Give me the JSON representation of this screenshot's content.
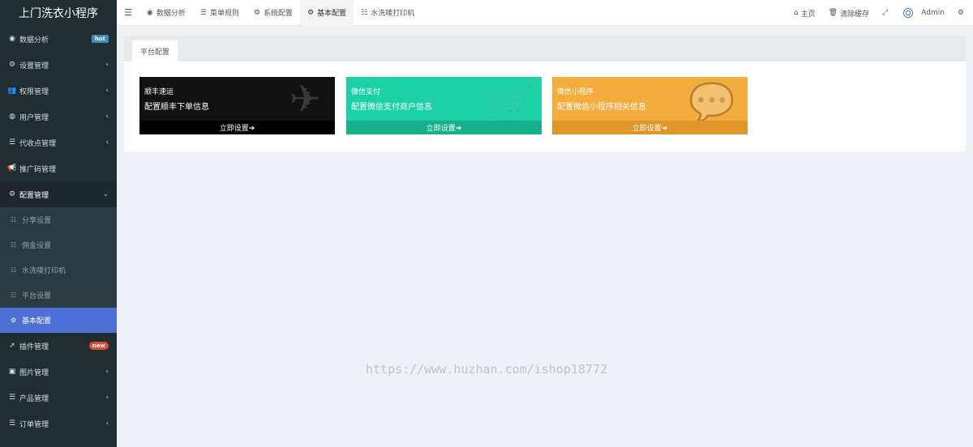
{
  "brand": "上门洗衣小程序",
  "sidebar": {
    "items": [
      {
        "label": "数据分析",
        "icon": "dashboard-icon",
        "glyph": "◉",
        "badge": "hot"
      },
      {
        "label": "设置管理",
        "icon": "cogs-icon",
        "glyph": "⚙",
        "arrow": "‹"
      },
      {
        "label": "权限管理",
        "icon": "users-icon",
        "glyph": "👥",
        "arrow": "‹"
      },
      {
        "label": "用户管理",
        "icon": "user-circle-icon",
        "glyph": "◍",
        "arrow": "‹"
      },
      {
        "label": "代收点管理",
        "icon": "list-icon",
        "glyph": "☰",
        "arrow": "‹"
      },
      {
        "label": "推广码管理",
        "icon": "bullhorn-icon",
        "glyph": "📢"
      },
      {
        "label": "配置管理",
        "icon": "gear-icon",
        "glyph": "⚙",
        "arrow": "⌄"
      }
    ],
    "submenu": [
      {
        "label": "分享设置",
        "icon": "list-alt-icon",
        "glyph": "☷"
      },
      {
        "label": "佣金设置",
        "icon": "list-alt-icon",
        "glyph": "☷"
      },
      {
        "label": "水洗唛打印机",
        "icon": "list-alt-icon",
        "glyph": "☷"
      },
      {
        "label": "平台设置",
        "icon": "list-alt-icon",
        "glyph": "☷"
      },
      {
        "label": "基本配置",
        "icon": "gear-icon",
        "glyph": "⚙"
      }
    ],
    "bottom_items": [
      {
        "label": "插件管理",
        "icon": "rocket-icon",
        "glyph": "➚",
        "badge": "new"
      },
      {
        "label": "图片管理",
        "icon": "image-icon",
        "glyph": "▣",
        "arrow": "‹"
      },
      {
        "label": "产品管理",
        "icon": "list-icon",
        "glyph": "☰",
        "arrow": "‹"
      },
      {
        "label": "订单管理",
        "icon": "list-icon",
        "glyph": "☰",
        "arrow": "‹"
      }
    ]
  },
  "topbar": {
    "hamburger": "☰",
    "tabs": [
      {
        "label": "数据分析",
        "glyph": "◉",
        "icon": "dashboard-icon"
      },
      {
        "label": "菜单规则",
        "glyph": "☰",
        "icon": "bars-icon"
      },
      {
        "label": "系统配置",
        "glyph": "⚙",
        "icon": "gear-icon"
      },
      {
        "label": "基本配置",
        "glyph": "⚙",
        "icon": "gear-icon"
      },
      {
        "label": "水洗唛打印机",
        "glyph": "☷",
        "icon": "list-alt-icon"
      }
    ],
    "right": {
      "home": "主页",
      "home_glyph": "⌂",
      "clear_cache": "清除缓存",
      "trash_glyph": "🗑",
      "fullscreen_glyph": "⤢",
      "user": "Admin"
    }
  },
  "panel": {
    "tab": "平台配置",
    "cards": [
      {
        "title": "顺丰速运",
        "desc": "配置顺丰下单信息",
        "action": "立即设置➔",
        "bg_glyph": "✈",
        "icon": "plane-icon"
      },
      {
        "title": "微信支付",
        "desc": "配置微信支付商户信息",
        "action": "立即设置➔",
        "bg_glyph": "🛒",
        "icon": "cart-icon"
      },
      {
        "title": "微信小程序",
        "desc": "配置微信小程序相关信息",
        "action": "立即设置➔",
        "bg_glyph": "💬",
        "icon": "wechat-icon"
      }
    ]
  },
  "watermark": "https://www.huzhan.com/ishop18772",
  "colors": {
    "sidebar_bg": "#222d32",
    "active_item": "#4d6fd6",
    "card_black": "#111111",
    "card_green": "#1bd1a5",
    "card_orange": "#f4ad3d"
  }
}
